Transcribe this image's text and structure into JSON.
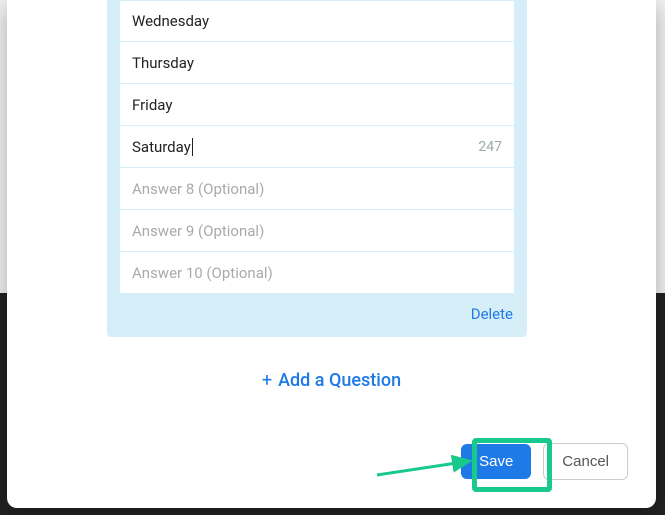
{
  "answers": [
    {
      "text": "Wednesday",
      "placeholder": false,
      "active": false,
      "count": ""
    },
    {
      "text": "Thursday",
      "placeholder": false,
      "active": false,
      "count": ""
    },
    {
      "text": "Friday",
      "placeholder": false,
      "active": false,
      "count": ""
    },
    {
      "text": "Saturday",
      "placeholder": false,
      "active": true,
      "count": "247"
    },
    {
      "text": "Answer 8 (Optional)",
      "placeholder": true,
      "active": false,
      "count": ""
    },
    {
      "text": "Answer 9 (Optional)",
      "placeholder": true,
      "active": false,
      "count": ""
    },
    {
      "text": "Answer 10 (Optional)",
      "placeholder": true,
      "active": false,
      "count": ""
    }
  ],
  "deleteLabel": "Delete",
  "addQuestionLabel": "Add a Question",
  "buttons": {
    "save": "Save",
    "cancel": "Cancel"
  }
}
